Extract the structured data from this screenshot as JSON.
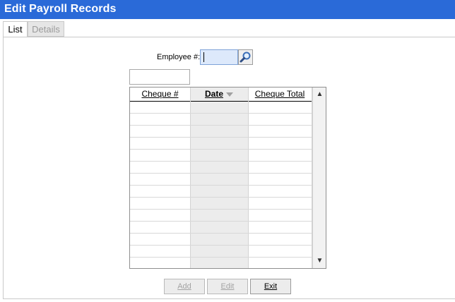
{
  "window": {
    "title": "Edit Payroll Records"
  },
  "tabs": [
    {
      "label": "List",
      "active": true
    },
    {
      "label": "Details",
      "active": false
    }
  ],
  "employee": {
    "label": "Employee #:",
    "value": "",
    "search_icon": "magnifier-icon"
  },
  "filter": {
    "value": ""
  },
  "grid": {
    "columns": [
      {
        "label": "Cheque #"
      },
      {
        "label": "Date",
        "sorted": "descending"
      },
      {
        "label": "Cheque Total"
      }
    ],
    "rows": []
  },
  "buttons": {
    "add": {
      "label": "Add",
      "enabled": false
    },
    "edit": {
      "label": "Edit",
      "enabled": false
    },
    "exit": {
      "label": "Exit",
      "enabled": true
    }
  },
  "colors": {
    "titlebar": "#2a6ad8",
    "input_focus": "#dde9fb",
    "sorted_column": "#ececec"
  }
}
